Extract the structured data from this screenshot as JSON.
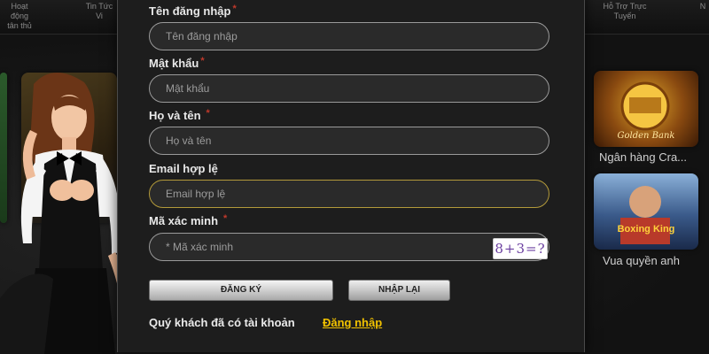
{
  "nav": {
    "item_left": "Hoạt động\ntân thủ",
    "item_left2": "Tin Tức\nVi",
    "item_right": "Hỗ Trợ Trực\nTuyến",
    "item_far_right": "N"
  },
  "games": {
    "golden_label": "Ngân hàng Cra...",
    "boxing_label": "Vua quyền anh",
    "golden_art_text": "Golden Bank",
    "boxing_art_text": "Boxing King"
  },
  "form": {
    "username": {
      "label": "Tên đăng nhập",
      "required": "*",
      "placeholder": "Tên đăng nhập"
    },
    "password": {
      "label": "Mật khẩu",
      "required": "*",
      "placeholder": "Mật khẩu"
    },
    "fullname": {
      "label": "Họ và tên",
      "required": "*",
      "placeholder": "Họ và tên"
    },
    "email": {
      "label": "Email hợp lệ",
      "placeholder": "Email hợp lệ"
    },
    "captcha": {
      "label": "Mã xác minh",
      "required": "*",
      "placeholder": "* Mã xác minh",
      "image_text": "8+3=?"
    },
    "register_button": "ĐĂNG KÝ",
    "reset_button": "NHẬP LẠI",
    "have_account_text": "Quý khách đã có tài khoản",
    "login_link": "Đăng nhập"
  },
  "colors": {
    "link": "#f2c200",
    "required_mark": "#c0392b",
    "focused_border": "#b39a3a"
  }
}
